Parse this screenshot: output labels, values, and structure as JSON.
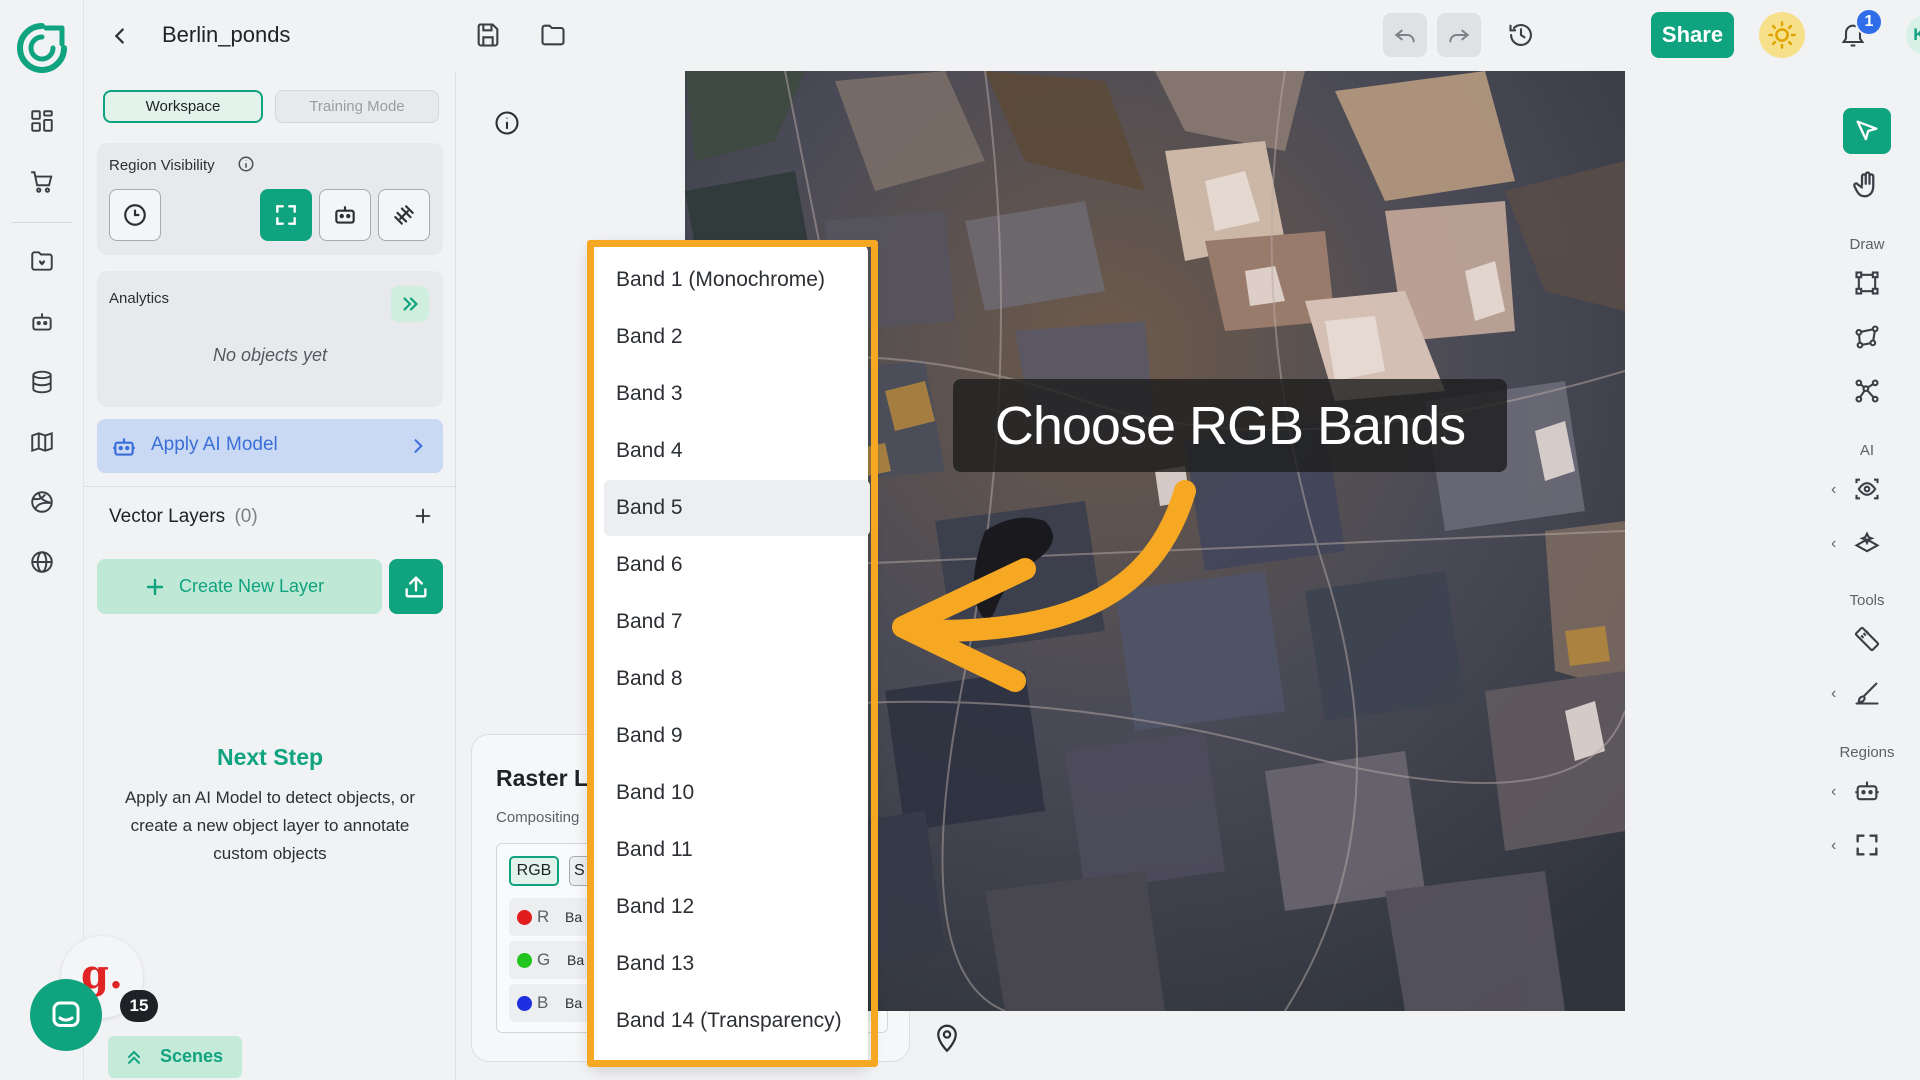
{
  "app": {
    "project_title": "Berlin_ponds",
    "share_label": "Share",
    "notification_count": "1",
    "user_initials": "KG"
  },
  "panel": {
    "tabs": {
      "workspace": "Workspace",
      "training": "Training Mode"
    },
    "region_visibility_label": "Region Visibility",
    "analytics": {
      "title": "Analytics",
      "empty_text": "No objects yet"
    },
    "apply_ai_label": "Apply AI Model",
    "vector_layers": {
      "title": "Vector Layers",
      "count": "(0)"
    },
    "create_layer_label": "Create New Layer",
    "next_step": {
      "title": "Next Step",
      "description": "Apply an AI Model to detect objects, or create a new object layer to annotate custom objects"
    },
    "scenes_label": "Scenes",
    "chat_badge_count": "15",
    "g_logo": "g."
  },
  "raster": {
    "title": "Raster L",
    "compositing_label": "Compositing",
    "mode_rgb": "RGB",
    "mode_other": "S",
    "channels": [
      {
        "letter": "R",
        "band_text": "Ba",
        "color": "#e11d1d"
      },
      {
        "letter": "G",
        "band_text": "Ba",
        "color": "#22c51e"
      },
      {
        "letter": "B",
        "band_text": "Ba",
        "color": "#1d2fe0"
      }
    ]
  },
  "dropdown": {
    "items": [
      "Band 1 (Monochrome)",
      "Band 2",
      "Band 3",
      "Band 4",
      "Band 5",
      "Band 6",
      "Band 7",
      "Band 8",
      "Band 9",
      "Band 10",
      "Band 11",
      "Band 12",
      "Band 13",
      "Band 14 (Transparency)"
    ],
    "hovered_index": 4
  },
  "callout": {
    "text": "Choose RGB Bands"
  },
  "right_toolbar": {
    "draw_label": "Draw",
    "ai_label": "AI",
    "tools_label": "Tools",
    "regions_label": "Regions"
  },
  "colors": {
    "accent": "#10a37f",
    "highlight": "#f7a823",
    "ai_blue": "#3b6fd8"
  }
}
